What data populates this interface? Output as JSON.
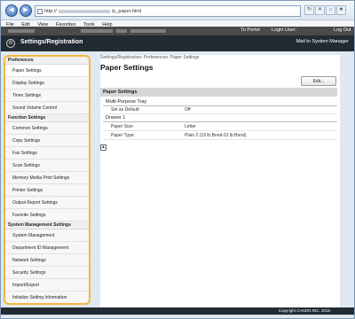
{
  "browser": {
    "address_prefix": "http://",
    "address_suffix": "/p_paper.html",
    "menu": [
      "File",
      "Edit",
      "View",
      "Favorites",
      "Tools",
      "Help"
    ],
    "nav_icons": [
      "back-arrow-icon",
      "forward-arrow-icon"
    ]
  },
  "header": {
    "to_portal": "To Portal",
    "login_user": "Login User:",
    "logout": "Log Out",
    "title": "Settings/Registration",
    "mail_admin": "Mail to System Manager"
  },
  "sidebar": {
    "groups": [
      {
        "title": "Preferences",
        "items": [
          "Paper Settings",
          "Display Settings",
          "Timer Settings",
          "Sound Volume Control"
        ]
      },
      {
        "title": "Function Settings",
        "items": [
          "Common Settings",
          "Copy Settings",
          "Fax Settings",
          "Scan Settings",
          "Memory Media Print Settings",
          "Printer Settings",
          "Output Report Settings",
          "Favorite Settings"
        ]
      },
      {
        "title": "System Management Settings",
        "items": [
          "System Management",
          "Department ID Management",
          "Network Settings",
          "Security Settings",
          "Import/Export",
          "Initialize Setting Information"
        ]
      }
    ]
  },
  "content": {
    "breadcrumb": "Settings/Registration: Preferences: Paper Settings",
    "title": "Paper Settings",
    "edit_button": "Edit...",
    "section_title": "Paper Settings",
    "mp_tray": {
      "heading": "Multi-Purpose Tray",
      "label": "Set as Default:",
      "value": "Off"
    },
    "drawer": {
      "heading": "Drawer 1",
      "size_label": "Paper Size:",
      "size_value": "Letter",
      "type_label": "Paper Type:",
      "type_value": "Plain 2 (19 lb Bond-22 lb Bond)"
    }
  },
  "footer": {
    "copyright": "Copyright CANON INC. 2015"
  },
  "colors": {
    "header_bg": "#222a33",
    "highlight_border": "#f5b73a"
  }
}
